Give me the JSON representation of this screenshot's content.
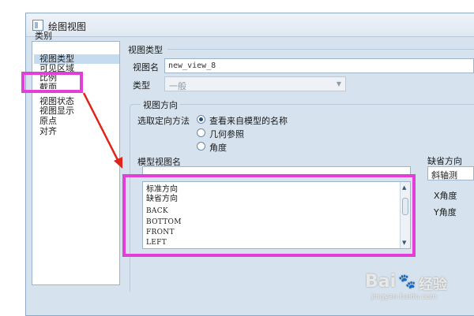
{
  "window": {
    "title": "绘图视图"
  },
  "categories": {
    "heading": "类别",
    "items": [
      "视图类型",
      "可见区域",
      "比例",
      "截面",
      "视图状态",
      "视图显示",
      "原点",
      "对齐"
    ]
  },
  "view_type": {
    "heading": "视图类型",
    "name_label": "视图名",
    "name_value": "new_view_8",
    "type_label": "类型",
    "type_value": "一般"
  },
  "orientation": {
    "heading": "视图方向",
    "method_label": "选取定向方法",
    "options": [
      "查看来自模型的名称",
      "几何参照",
      "角度"
    ],
    "selected_index": 0,
    "model_view_label": "模型视图名",
    "model_views": [
      "标准方向",
      "缺省方向",
      "BACK",
      "BOTTOM",
      "FRONT",
      "LEFT"
    ],
    "default_orientation_label": "缺省方向",
    "default_orientation_value": "斜轴测",
    "x_angle_label": "X角度",
    "y_angle_label": "Y角度"
  },
  "watermark": {
    "brand": "Bai",
    "brand2": "经验",
    "url": "jingyan.baidu.com"
  },
  "colors": {
    "highlight": "#e33fd8",
    "arrow": "#e0241b",
    "window_bg": "#d6e3ee"
  }
}
